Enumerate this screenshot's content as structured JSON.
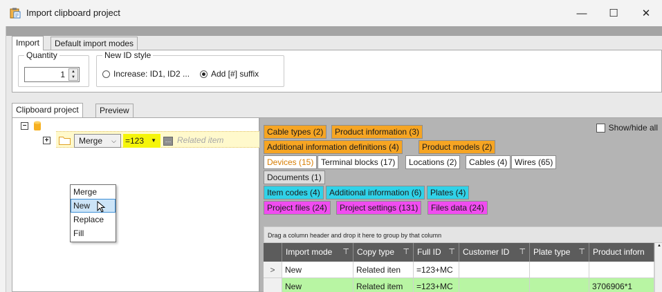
{
  "window": {
    "title": "Import clipboard project",
    "minimize_glyph": "—",
    "maximize_glyph": "☐",
    "close_glyph": "✕"
  },
  "main_tabs": [
    "Import",
    "Default import modes"
  ],
  "quantity": {
    "label": "Quantity",
    "value": "1"
  },
  "new_id_style": {
    "label": "New ID style",
    "options": [
      "Increase: ID1, ID2 ...",
      "Add [#] suffix"
    ],
    "selected": "Add [#] suffix"
  },
  "content_tabs": [
    "Clipboard project",
    "Preview"
  ],
  "tree": {
    "merge_combo_value": "Merge",
    "id_value": "=123",
    "related_label": "Related item",
    "dropdown_options": [
      "Merge",
      "New",
      "Replace",
      "Fill"
    ],
    "dropdown_selected": "New"
  },
  "category_tabs": {
    "row1": [
      "Cable types (2)",
      "Product information (3)"
    ],
    "row2": [
      "Additional information definitions (4)",
      "Product models (2)"
    ],
    "row3": [
      "Devices (15)",
      "Terminal blocks (17)",
      "Locations (2)",
      "Cables (4)",
      "Wires (65)"
    ],
    "row4": [
      "Documents (1)"
    ],
    "row5": [
      "Item codes (4)",
      "Additional information (6)",
      "Plates (4)"
    ],
    "row6": [
      "Project files (24)",
      "Project settings (131)",
      "Files data (24)"
    ]
  },
  "show_hide_label": "Show/hide all",
  "grid": {
    "group_hint": "Drag a column header and drop it here to group by that column",
    "columns": [
      "Import mode",
      "Copy type",
      "Full ID",
      "Customer ID",
      "Plate type",
      "Product inforn"
    ],
    "rows": [
      [
        "New",
        "Related iten",
        "=123+MC",
        "",
        "",
        ""
      ],
      [
        "New",
        "Related item",
        "=123+MC",
        "",
        "",
        "3706906*1"
      ]
    ],
    "row_indicator": ">"
  },
  "colors": {
    "orange_tab": "#f6a523",
    "cyan_tab": "#30d2e8",
    "magenta_tab": "#f04cf0",
    "yellow_id": "#f5f50a",
    "green_row": "#b8f5a3",
    "grid_header": "#5c5c5c"
  },
  "icons": [
    "app-icon",
    "folder-icon",
    "database-icon",
    "expand-icon",
    "filter-icon",
    "cursor-icon"
  ]
}
